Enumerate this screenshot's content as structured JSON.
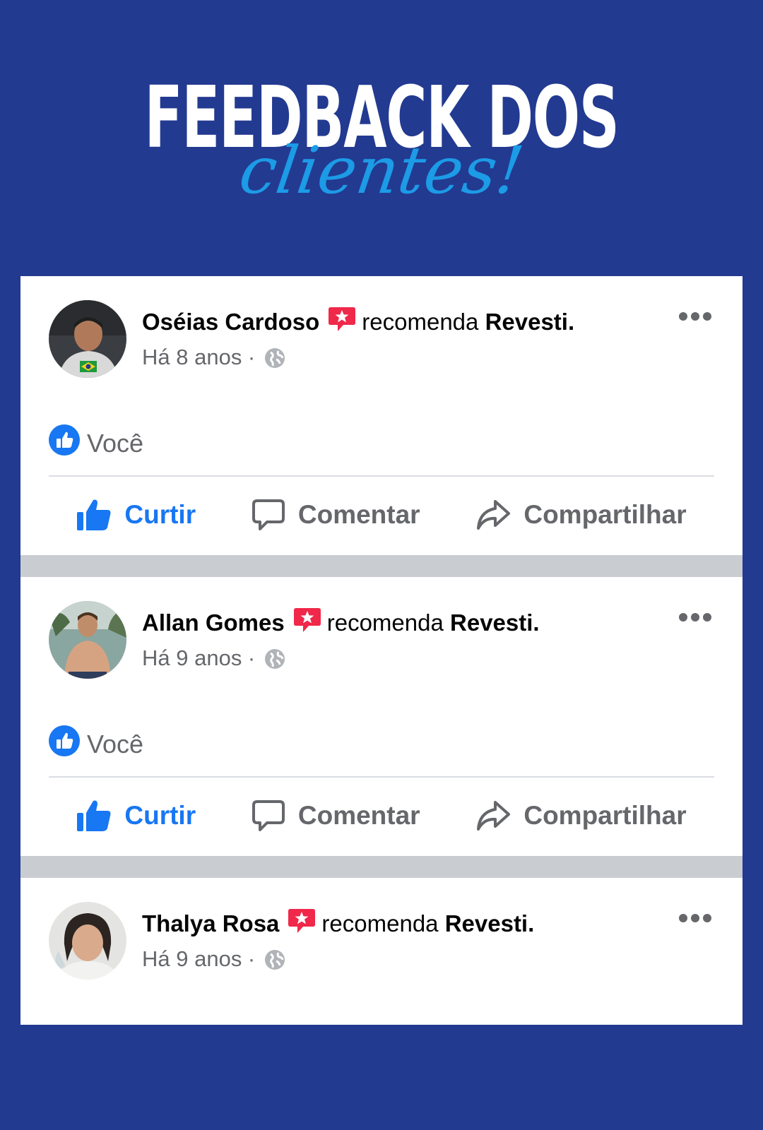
{
  "headline": {
    "main": "FEEDBACK DOS",
    "script": "clientes!"
  },
  "colors": {
    "background": "#233a91",
    "accent_script": "#1c9be6",
    "facebook_blue": "#1877f2",
    "recommend_red": "#f02849",
    "separator": "#c9ccd1"
  },
  "posts": [
    {
      "name": "Oséias Cardoso",
      "verb": "recomenda",
      "page": "Revesti.",
      "time": "Há 8 anos ·",
      "liker": "Você",
      "actions": {
        "like": "Curtir",
        "comment": "Comentar",
        "share": "Compartilhar"
      },
      "icons": {
        "badge": "recommend-star-icon",
        "privacy": "globe-icon",
        "more": "more-options-icon"
      }
    },
    {
      "name": "Allan Gomes",
      "verb": "recomenda",
      "page": "Revesti.",
      "time": "Há 9 anos ·",
      "liker": "Você",
      "actions": {
        "like": "Curtir",
        "comment": "Comentar",
        "share": "Compartilhar"
      },
      "icons": {
        "badge": "recommend-star-icon",
        "privacy": "globe-icon",
        "more": "more-options-icon"
      }
    },
    {
      "name": "Thalya Rosa",
      "verb": "recomenda",
      "page": "Revesti.",
      "time": "Há 9 anos ·",
      "icons": {
        "badge": "recommend-star-icon",
        "privacy": "globe-icon",
        "more": "more-options-icon"
      }
    }
  ]
}
